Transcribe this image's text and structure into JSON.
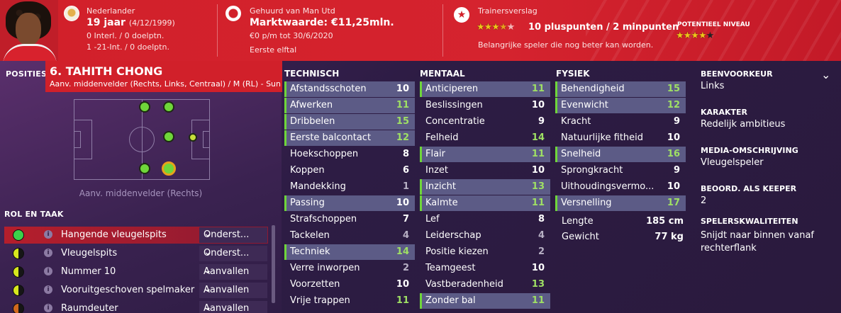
{
  "header": {
    "nation": "Nederlander",
    "age": "19 jaar",
    "dob": "(4/12/1999)",
    "intl": "0 Interl. / 0 doelptn.",
    "u21": "1 -21-Int. / 0 doelptn.",
    "loan": "Gehuurd van Man Utd",
    "value": "Marktwaarde: €11,25mln.",
    "wage": "€0 p/m tot 30/6/2020",
    "squad": "Eerste elftal",
    "report_title": "Trainersverslag",
    "report_summary": "10 pluspunten / 2 minpunten",
    "report_text": "Belangrijke speler die nog beter kan worden.",
    "potential_label": "POTENTIEEL NIVEAU",
    "current_stars": 3.5,
    "potential_stars": 4
  },
  "player": {
    "name": "6. TAHITH CHONG",
    "positions": "Aanv. middenvelder (Rechts, Links, Centraal) / M (RL) - Sunderland"
  },
  "positions_title": "POSITIES",
  "pos_label": "Aanv. middenvelder (Rechts)",
  "roles_title": "ROL EN TAAK",
  "roles": [
    {
      "name": "Hangende vleugelspits",
      "duty": "Onderst...",
      "icon": "full",
      "selected": true
    },
    {
      "name": "Vleugelspits",
      "duty": "Onderst...",
      "icon": "half",
      "selected": false
    },
    {
      "name": "Nummer 10",
      "duty": "Aanvallen",
      "icon": "half",
      "selected": false
    },
    {
      "name": "Vooruitgeschoven spelmaker",
      "duty": "Aanvallen",
      "icon": "half",
      "selected": false
    },
    {
      "name": "Raumdeuter",
      "duty": "Aanvallen",
      "icon": "ora",
      "selected": false
    }
  ],
  "technical": {
    "title": "TECHNISCH",
    "items": [
      {
        "name": "Afstandsschoten",
        "value": 10,
        "hl": true
      },
      {
        "name": "Afwerken",
        "value": 11,
        "hl": true
      },
      {
        "name": "Dribbelen",
        "value": 15,
        "hl": true
      },
      {
        "name": "Eerste balcontact",
        "value": 12,
        "hl": true
      },
      {
        "name": "Hoekschoppen",
        "value": 8,
        "hl": false
      },
      {
        "name": "Koppen",
        "value": 6,
        "hl": false
      },
      {
        "name": "Mandekking",
        "value": 1,
        "hl": false
      },
      {
        "name": "Passing",
        "value": 10,
        "hl": true
      },
      {
        "name": "Strafschoppen",
        "value": 7,
        "hl": false
      },
      {
        "name": "Tackelen",
        "value": 4,
        "hl": false
      },
      {
        "name": "Techniek",
        "value": 14,
        "hl": true
      },
      {
        "name": "Verre inworpen",
        "value": 2,
        "hl": false
      },
      {
        "name": "Voorzetten",
        "value": 10,
        "hl": false
      },
      {
        "name": "Vrije trappen",
        "value": 11,
        "hl": false
      }
    ]
  },
  "mental": {
    "title": "MENTAAL",
    "items": [
      {
        "name": "Anticiperen",
        "value": 11,
        "hl": true
      },
      {
        "name": "Beslissingen",
        "value": 10,
        "hl": false
      },
      {
        "name": "Concentratie",
        "value": 9,
        "hl": false
      },
      {
        "name": "Felheid",
        "value": 14,
        "hl": false
      },
      {
        "name": "Flair",
        "value": 11,
        "hl": true
      },
      {
        "name": "Inzet",
        "value": 10,
        "hl": false
      },
      {
        "name": "Inzicht",
        "value": 13,
        "hl": true
      },
      {
        "name": "Kalmte",
        "value": 11,
        "hl": true
      },
      {
        "name": "Lef",
        "value": 8,
        "hl": false
      },
      {
        "name": "Leiderschap",
        "value": 4,
        "hl": false
      },
      {
        "name": "Positie kiezen",
        "value": 2,
        "hl": false
      },
      {
        "name": "Teamgeest",
        "value": 10,
        "hl": false
      },
      {
        "name": "Vastberadenheid",
        "value": 13,
        "hl": false
      },
      {
        "name": "Zonder bal",
        "value": 11,
        "hl": true
      }
    ]
  },
  "physical": {
    "title": "FYSIEK",
    "items": [
      {
        "name": "Behendigheid",
        "value": 15,
        "hl": true
      },
      {
        "name": "Evenwicht",
        "value": 12,
        "hl": true
      },
      {
        "name": "Kracht",
        "value": 9,
        "hl": false
      },
      {
        "name": "Natuurlijke fitheid",
        "value": 10,
        "hl": false
      },
      {
        "name": "Snelheid",
        "value": 16,
        "hl": true
      },
      {
        "name": "Sprongkracht",
        "value": 9,
        "hl": false
      },
      {
        "name": "Uithoudingsvermo...",
        "value": 10,
        "hl": false
      },
      {
        "name": "Versnelling",
        "value": 17,
        "hl": true
      }
    ],
    "height_label": "Lengte",
    "height": "185 cm",
    "weight_label": "Gewicht",
    "weight": "77 kg"
  },
  "info": {
    "foot_title": "BEENVOORKEUR",
    "foot": "Links",
    "char_title": "KARAKTER",
    "char": "Redelijk ambitieus",
    "media_title": "MEDIA-OMSCHRIJVING",
    "media": "Vleugelspeler",
    "keeper_title": "BEOORD. ALS KEEPER",
    "keeper": "2",
    "traits_title": "SPELERSKWALITEITEN",
    "traits_line1": "Snijdt naar binnen vanaf",
    "traits_line2": "rechterflank"
  }
}
